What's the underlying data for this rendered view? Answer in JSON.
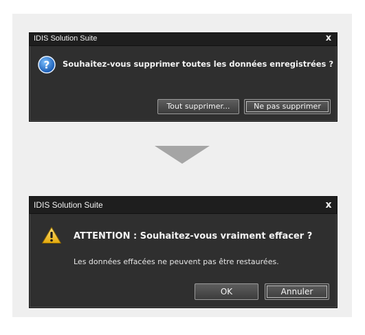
{
  "dialog1": {
    "title": "IDIS Solution Suite",
    "close_label": "x",
    "message": "Souhaitez-vous supprimer toutes les données enregistrées ?",
    "buttons": {
      "delete_all": "Tout supprimer...",
      "do_not_delete": "Ne pas supprimer"
    }
  },
  "dialog2": {
    "title": "IDIS Solution Suite",
    "close_label": "x",
    "message_title": "ATTENTION : Souhaitez-vous vraiment effacer ?",
    "message_detail": "Les données effacées ne peuvent pas être restaurées.",
    "buttons": {
      "ok": "OK",
      "cancel": "Annuler"
    }
  },
  "colors": {
    "dialog_bg": "#2f2f2f",
    "titlebar_bg": "#1e1e1e",
    "panel_bg": "#efefef",
    "arrow": "#a5a5a5",
    "question_icon": "#1f78d1",
    "warning_icon": "#f2c318"
  },
  "icons": {
    "dialog1": "question-icon",
    "dialog2": "warning-icon",
    "close": "close-icon",
    "flow": "arrow-down-icon"
  }
}
